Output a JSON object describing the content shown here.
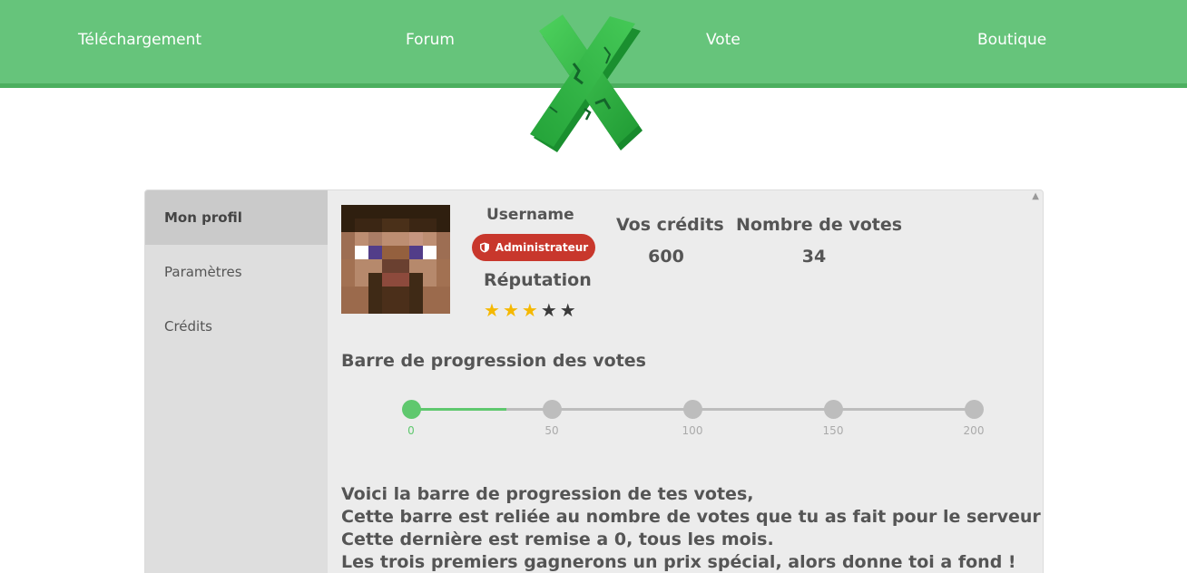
{
  "nav": {
    "items": [
      {
        "label": "Téléchargement"
      },
      {
        "label": "Forum"
      },
      {
        "label": "Vote"
      },
      {
        "label": "Boutique"
      }
    ],
    "logo_icon": "green-x-logo-icon"
  },
  "sidebar": {
    "items": [
      {
        "label": "Mon profil",
        "active": true
      },
      {
        "label": "Paramètres",
        "active": false
      },
      {
        "label": "Crédits",
        "active": false
      }
    ]
  },
  "profile": {
    "username": "Username",
    "role_badge": "Administrateur",
    "role_icon": "shield-icon",
    "reputation_label": "Réputation",
    "reputation_stars": 3,
    "reputation_max": 5,
    "credits_label": "Vos crédits",
    "credits_value": "600",
    "votes_label": "Nombre de votes",
    "votes_value": "34"
  },
  "progress": {
    "title": "Barre de progression des votes",
    "ticks": [
      "0",
      "50",
      "100",
      "150",
      "200"
    ],
    "current_votes": 34,
    "max_votes": 200
  },
  "message": {
    "lines": [
      "Voici la barre de progression de tes votes,",
      "Cette barre est reliée au nombre de votes que tu as fait pour le serveur",
      "Cette dernière est remise a 0, tous les mois.",
      "Les trois premiers gagnerons un prix spécial, alors donne toi a fond !"
    ]
  },
  "colors": {
    "header_green": "#66c47b",
    "accent_green": "#5fc86e",
    "badge_red": "#c8372c",
    "star_gold": "#f5b800"
  }
}
